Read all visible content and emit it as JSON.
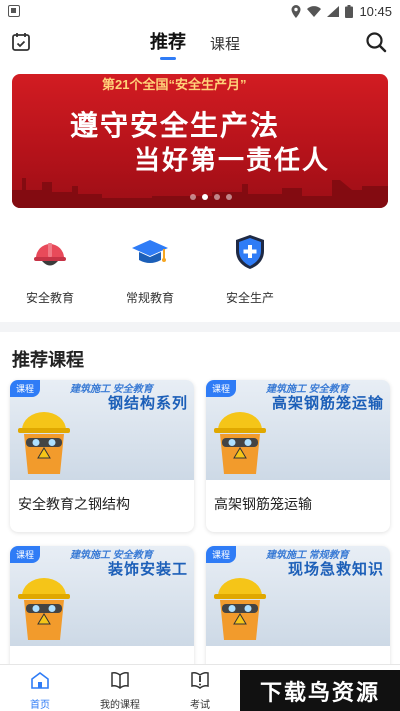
{
  "status_bar": {
    "time": "10:45"
  },
  "header": {
    "tabs": [
      {
        "label": "推荐",
        "active": true
      },
      {
        "label": "课程",
        "active": false
      }
    ],
    "icons": {
      "left": "calendar-check-icon",
      "right": "search-icon"
    }
  },
  "banner": {
    "top_text": "第21个全国“安全生产月”",
    "line1": "遵守安全生产法",
    "line2": "当好第一责任人",
    "slide_index": 1,
    "slide_count": 4
  },
  "quick_entries": [
    {
      "label": "安全教育",
      "icon": "helmet-icon"
    },
    {
      "label": "常规教育",
      "icon": "graduation-cap-icon"
    },
    {
      "label": "安全生产",
      "icon": "shield-plus-icon"
    }
  ],
  "section": {
    "title": "推荐课程"
  },
  "courses": [
    {
      "badge": "课程",
      "thumb_top": "建筑施工 安全教育",
      "thumb_title": "钢结构系列",
      "title": "安全教育之钢结构"
    },
    {
      "badge": "课程",
      "thumb_top": "建筑施工 安全教育",
      "thumb_title": "高架钢筋笼运输",
      "title": "高架钢筋笼运输"
    },
    {
      "badge": "课程",
      "thumb_top": "建筑施工 安全教育",
      "thumb_title": "装饰安装工",
      "title": ""
    },
    {
      "badge": "课程",
      "thumb_top": "建筑施工 常规教育",
      "thumb_title": "现场急救知识",
      "title": ""
    }
  ],
  "bottom_nav": [
    {
      "label": "首页",
      "icon": "home-icon",
      "active": true
    },
    {
      "label": "我的课程",
      "icon": "book-icon",
      "active": false
    },
    {
      "label": "考试",
      "icon": "exam-icon",
      "active": false
    }
  ],
  "watermark": "下载鸟资源",
  "colors": {
    "accent": "#2f7cf6",
    "banner_red": "#c8161e",
    "divider": "#f3f4f6"
  }
}
